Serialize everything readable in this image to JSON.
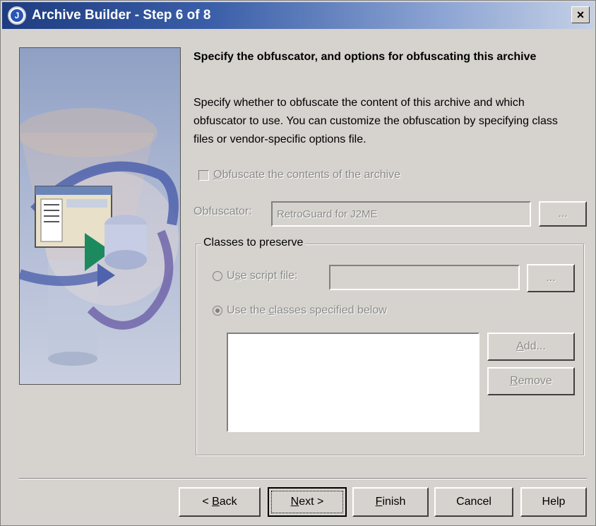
{
  "window": {
    "title": "Archive Builder - Step 6 of 8",
    "close_label": "×"
  },
  "content": {
    "heading": "Specify the obfuscator, and options for obfuscating this archive",
    "description": "Specify whether to obfuscate the content of this archive and which obfuscator to use. You can customize the obfuscation by specifying class files or vendor-specific options file."
  },
  "obfuscate_checkbox": {
    "label_first": "O",
    "label_rest": "bfuscate the contents of the archive",
    "checked": false,
    "enabled": false
  },
  "obfuscator": {
    "label": "Obfuscator:",
    "value": "RetroGuard for J2ME",
    "browse_label": "..."
  },
  "classes_group": {
    "legend": "Classes to preserve",
    "script_radio_label_pre": "U",
    "script_radio_label_mnemonic": "s",
    "script_radio_label_post": "e script file:",
    "script_value": "",
    "script_browse_label": "...",
    "classes_radio_label_pre": "Use the ",
    "classes_radio_label_mnemonic": "c",
    "classes_radio_label_post": "lasses specified below",
    "selected": "classes",
    "add_label_mnemonic": "A",
    "add_label_rest": "dd...",
    "remove_label_mnemonic": "R",
    "remove_label_rest": "emove",
    "list_items": []
  },
  "footer": {
    "back_pre": "< ",
    "back_mnemonic": "B",
    "back_post": "ack",
    "next_mnemonic": "N",
    "next_post": "ext >",
    "finish_mnemonic": "F",
    "finish_post": "inish",
    "cancel_label": "Cancel",
    "help_label": "Help"
  },
  "colors": {
    "titlebar_start": "#1e3c80",
    "titlebar_end": "#c4d0e6",
    "dialog_bg": "#d6d3ce",
    "disabled_text": "#8a8a8a"
  },
  "icons": {
    "app": "jdeveloper-icon",
    "close": "close-icon",
    "illustration": "archive-wizard-illustration"
  }
}
